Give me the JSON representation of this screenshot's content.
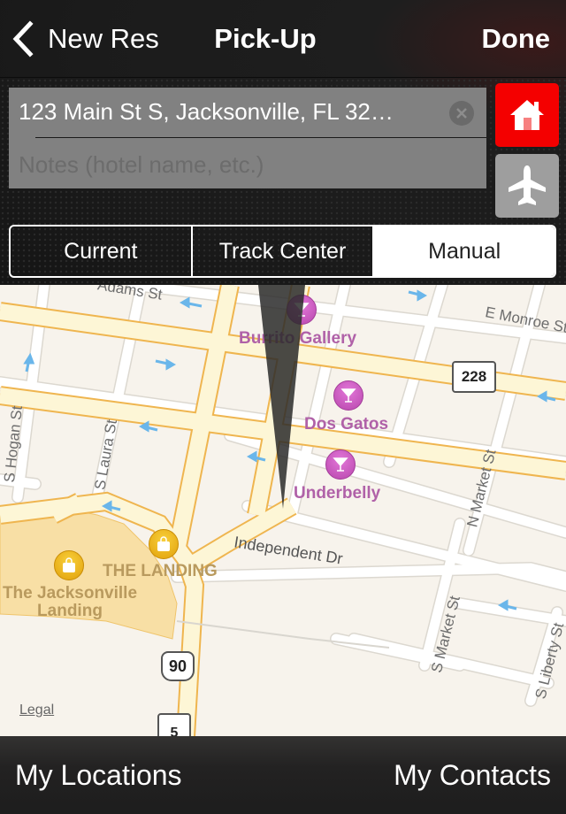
{
  "navbar": {
    "back_label": "New Res",
    "title": "Pick-Up",
    "done_label": "Done"
  },
  "form": {
    "address_value": "123 Main St S, Jacksonville, FL 32…",
    "notes_placeholder": "Notes (hotel name, etc.)"
  },
  "quick_buttons": {
    "home_color": "#f40000",
    "airport_color": "#9e9e9e"
  },
  "location_mode": {
    "options": [
      "Current",
      "Track Center",
      "Manual"
    ],
    "selected": "Manual"
  },
  "map": {
    "street_labels": {
      "adams": "Adams St",
      "monroe": "E Monroe St",
      "hogan": "S Hogan St",
      "laura": "S Laura St",
      "independent": "Independent Dr",
      "n_market": "N Market St",
      "s_market": "S Market St",
      "s_liberty": "S Liberty St"
    },
    "pois": [
      {
        "name": "Burrito Gallery",
        "type": "bar"
      },
      {
        "name": "Dos Gatos",
        "type": "bar"
      },
      {
        "name": "Underbelly",
        "type": "bar"
      },
      {
        "name": "THE LANDING",
        "type": "shopping"
      },
      {
        "name": "The Jacksonville Landing",
        "type": "shopping"
      }
    ],
    "landing_label_line1": "The Jacksonville",
    "landing_label_line2": "Landing",
    "route_shields": {
      "fl_228": "228",
      "us_90": "90",
      "fl_5": "5"
    },
    "legal_label": "Legal"
  },
  "bottom_bar": {
    "left_label": "My Locations",
    "right_label": "My Contacts"
  }
}
